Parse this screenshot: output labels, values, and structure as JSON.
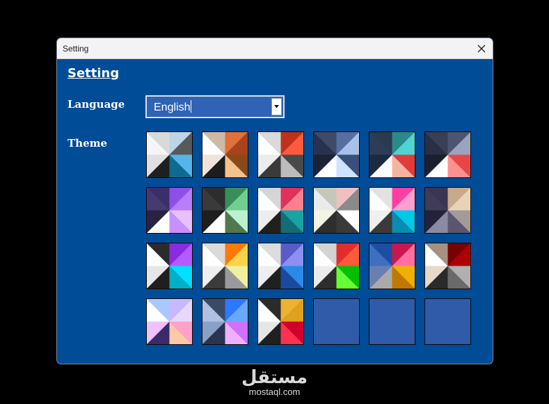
{
  "window": {
    "title": "Setting"
  },
  "settings": {
    "heading": "Setting",
    "language_label": "Language",
    "language_value": "English",
    "theme_label": "Theme"
  },
  "themes": [
    [
      "#d9d9d9",
      "#bdd3e6",
      "#595959",
      "#56b4e9",
      "#0e6b8f",
      "#1f1f1f",
      "#e0e0e0",
      "#f5f5f5"
    ],
    [
      "#cdb9a5",
      "#e0713a",
      "#a9431d",
      "#8a4a18",
      "#f6c28a",
      "#1d1d1d",
      "#efe4d8",
      "#ffffff"
    ],
    [
      "#dadada",
      "#c0311b",
      "#ff5a3d",
      "#4a4a4a",
      "#bcbcbc",
      "#3a3a3a",
      "#ececec",
      "#ffffff"
    ],
    [
      "#3e4a66",
      "#5570a0",
      "#a9c0e8",
      "#3b4f7c",
      "#cfe2ff",
      "#ffffff",
      "#1b2238",
      "#283250"
    ],
    [
      "#2a3a50",
      "#2a8a8a",
      "#4fd4d4",
      "#e23b3b",
      "#f5b4a0",
      "#ffffff",
      "#1b2a3f",
      "#2e3c55"
    ],
    [
      "#3a3f55",
      "#4b5470",
      "#9aa4c0",
      "#e84646",
      "#ff9090",
      "#ffffff",
      "#1b1f2e",
      "#2a2f44"
    ],
    [
      "#3b2e6b",
      "#8d50e6",
      "#b87dff",
      "#e9c0ff",
      "#c88fff",
      "#ffffff",
      "#2a2244",
      "#463a70"
    ],
    [
      "#2d2d2d",
      "#3a8d5a",
      "#6fcf8f",
      "#bdf0cf",
      "#4f7a4f",
      "#ffffff",
      "#1e1e1e",
      "#3a3a3a"
    ],
    [
      "#d5d5d5",
      "#e0315a",
      "#ff7f8e",
      "#1aa3a3",
      "#116d78",
      "#202020",
      "#ededed",
      "#ffffff"
    ],
    [
      "#c7c7b8",
      "#f0c0c0",
      "#8a8a8a",
      "#ffffff",
      "#3a3a3a",
      "#2e2e2e",
      "#f4f4e6",
      "#eaeaea"
    ],
    [
      "#e2e2e2",
      "#ff3fa0",
      "#ff9ed0",
      "#00c8e8",
      "#0a8cb0",
      "#3a3a3a",
      "#f0f0f0",
      "#ffffff"
    ],
    [
      "#3a3550",
      "#c8a98a",
      "#e8d2b8",
      "#a49a9a",
      "#5a5670",
      "#8a8aa0",
      "#24223a",
      "#403c58"
    ],
    [
      "#2b2b2b",
      "#8a2be2",
      "#b25cff",
      "#00e0ff",
      "#00b0c8",
      "#1f1f1f",
      "#e6e6e6",
      "#ffffff"
    ],
    [
      "#dadada",
      "#ff7a00",
      "#ffd24a",
      "#f0f0a0",
      "#9a9a9a",
      "#3b3b3b",
      "#efefef",
      "#ffffff"
    ],
    [
      "#dcdcdc",
      "#5a5ac8",
      "#8f8ff0",
      "#2a8ae6",
      "#1a4aa0",
      "#202020",
      "#eeeeee",
      "#ffffff"
    ],
    [
      "#d3d3d3",
      "#e22d2d",
      "#ff5a3a",
      "#00c000",
      "#66ff33",
      "#2d2d2d",
      "#ececec",
      "#ffffff"
    ],
    [
      "#1e4ea0",
      "#c8174f",
      "#ff6fa0",
      "#f0b000",
      "#c07800",
      "#aaaaaa",
      "#6a7fb0",
      "#3f6fc0"
    ],
    [
      "#a89080",
      "#7a0000",
      "#b00000",
      "#b0b0b0",
      "#6a6a6a",
      "#2a2a2a",
      "#e8d8c8",
      "#ffffff"
    ],
    [
      "#a8c8ff",
      "#c8b8ff",
      "#e8d8ff",
      "#ffa0c8",
      "#ffc8a8",
      "#3a2a6a",
      "#f0c0ff",
      "#ffffff"
    ],
    [
      "#3a4a66",
      "#2a7aff",
      "#6aa8ff",
      "#d070ff",
      "#f0b0ff",
      "#2a3450",
      "#8aa0c8",
      "#b0c0e0"
    ],
    [
      "#2b2b2b",
      "#f0b030",
      "#e0a020",
      "#d0002a",
      "#ff3050",
      "#1f1f1f",
      "#e6e6e6",
      "#ffffff"
    ],
    null,
    null,
    null
  ]
}
